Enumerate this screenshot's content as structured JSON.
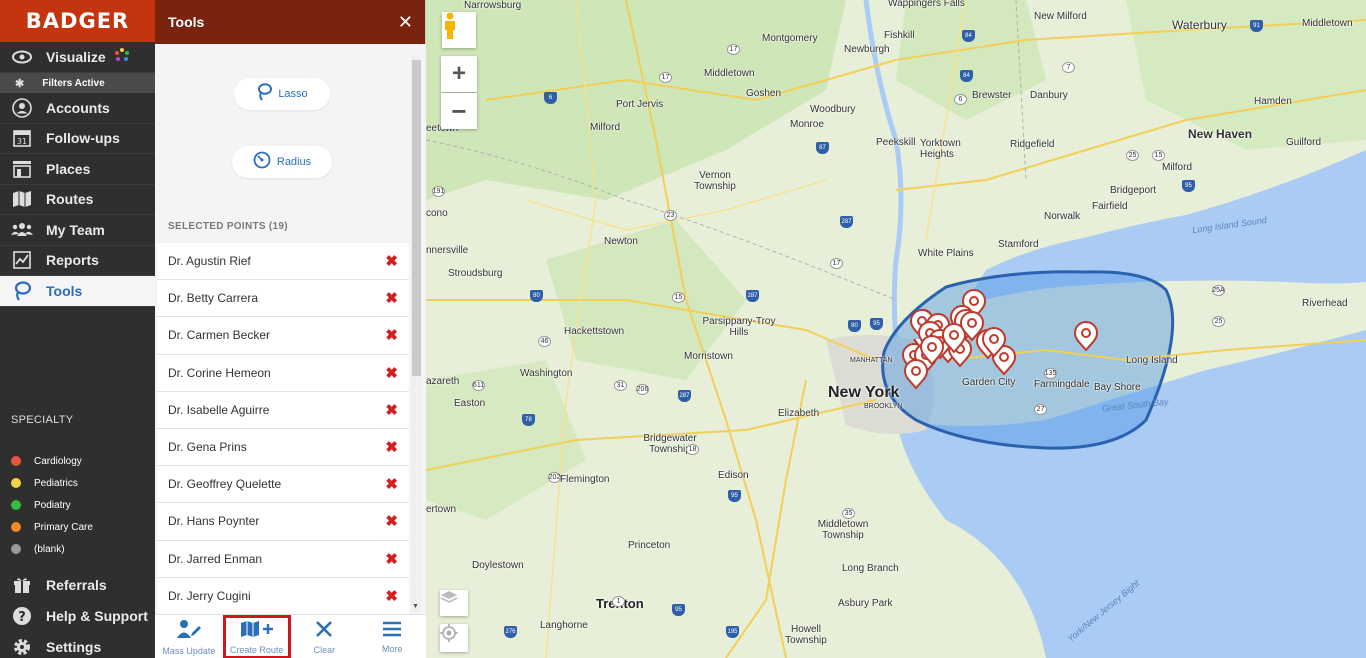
{
  "brand": "BADGER",
  "nav": {
    "visualize": "Visualize",
    "filters_active": "Filters Active",
    "items": [
      {
        "label": "Accounts",
        "icon": "person-icon"
      },
      {
        "label": "Follow-ups",
        "icon": "calendar-icon"
      },
      {
        "label": "Places",
        "icon": "store-icon"
      },
      {
        "label": "Routes",
        "icon": "map-icon"
      },
      {
        "label": "My Team",
        "icon": "team-icon"
      },
      {
        "label": "Reports",
        "icon": "chart-icon"
      },
      {
        "label": "Tools",
        "icon": "lasso-icon"
      }
    ],
    "bottom": [
      {
        "label": "Referrals",
        "icon": "gift-icon"
      },
      {
        "label": "Help & Support",
        "icon": "help-icon"
      },
      {
        "label": "Settings",
        "icon": "gear-icon"
      }
    ]
  },
  "specialty": {
    "title": "SPECIALTY",
    "items": [
      {
        "label": "Cardiology",
        "color": "#e8553c"
      },
      {
        "label": "Pediatrics",
        "color": "#f2d343"
      },
      {
        "label": "Podiatry",
        "color": "#2fbf3a"
      },
      {
        "label": "Primary Care",
        "color": "#f08a2b"
      },
      {
        "label": "(blank)",
        "color": "#9a9a9a"
      }
    ]
  },
  "panel": {
    "title": "Tools",
    "lasso": "Lasso",
    "radius": "Radius",
    "selected_title": "SELECTED POINTS (19)",
    "points": [
      "Dr. Agustin Rief",
      "Dr. Betty Carrera",
      "Dr. Carmen Becker",
      "Dr. Corine Hemeon",
      "Dr. Isabelle Aguirre",
      "Dr. Gena Prins",
      "Dr. Geoffrey Quelette",
      "Dr. Hans Poynter",
      "Dr. Jarred Enman",
      "Dr. Jerry Cugini"
    ],
    "footer": {
      "mass_update": "Mass Update",
      "create_route": "Create Route",
      "clear": "Clear",
      "more": "More"
    }
  },
  "map": {
    "labels": {
      "narrowsburg": "Narrowsburg",
      "wappingers": "Wappingers Falls",
      "fishkill": "Fishkill",
      "new_milford": "New Milford",
      "waterbury": "Waterbury",
      "middletown_ct": "Middletown",
      "montgomery": "Montgomery",
      "newburgh": "Newburgh",
      "middletown": "Middletown",
      "goshen": "Goshen",
      "brewster": "Brewster",
      "danbury": "Danbury",
      "hamden": "Hamden",
      "port_jervis": "Port Jervis",
      "woodbury": "Woodbury",
      "monroe": "Monroe",
      "milford": "Milford",
      "new_haven": "New Haven",
      "peekskill": "Peekskill",
      "yorktown": "Yorktown Heights",
      "ridgefield": "Ridgefield",
      "guilford": "Guilford",
      "milford_ct": "Milford",
      "vernon": "Vernon Township",
      "bridgeport": "Bridgeport",
      "fairfield": "Fairfield",
      "norwalk": "Norwalk",
      "long_island_sound": "Long Island Sound",
      "newton": "Newton",
      "white_plains": "White Plains",
      "stamford": "Stamford",
      "stroudsburg": "Stroudsburg",
      "riverhead": "Riverhead",
      "parsippany": "Parsippany-Troy Hills",
      "hackettstown": "Hackettstown",
      "morristown": "Morristown",
      "manhattan": "MANHATTAN",
      "long_island": "Long Island",
      "washington": "Washington",
      "garden_city": "Garden City",
      "farmingdale": "Farmingdale",
      "new_york": "New York",
      "brooklyn": "BROOKLYN",
      "bay_shore": "Bay Shore",
      "easton": "Easton",
      "elizabeth": "Elizabeth",
      "great_south_bay": "Great South Bay",
      "bridgewater": "Bridgewater Township",
      "flemington": "Flemington",
      "edison": "Edison",
      "middletown_nj": "Middletown Township",
      "doylestown": "Doylestown",
      "princeton": "Princeton",
      "long_branch": "Long Branch",
      "trenton": "Trenton",
      "asbury_park": "Asbury Park",
      "langhorne": "Langhorne",
      "howell": "Howell Township",
      "ny_nj_bight": "York/New Jersey Bight",
      "nersville": "nnersville",
      "hazareth": "azareth",
      "eetown": "eetown",
      "ertown": "ertown",
      "acono": "cono"
    }
  }
}
